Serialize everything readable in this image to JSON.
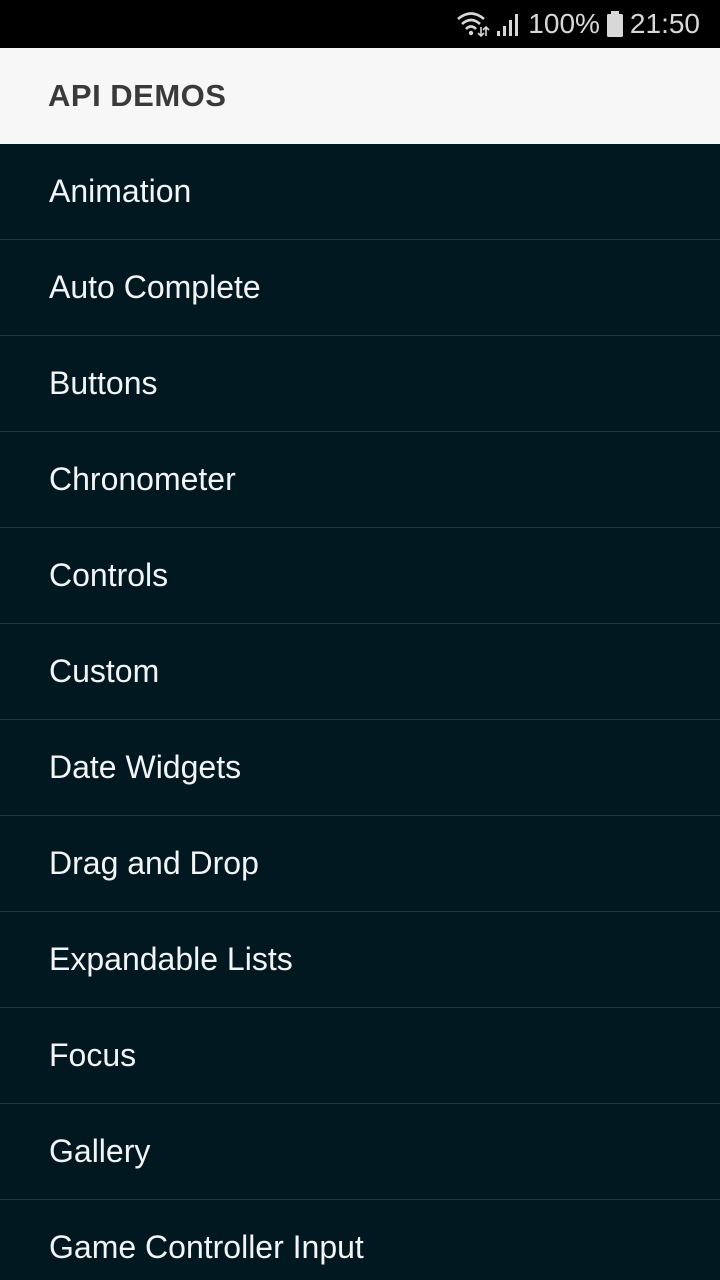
{
  "status_bar": {
    "battery": "100%",
    "time": "21:50",
    "icons": [
      "wifi-icon",
      "signal-icon",
      "battery-icon"
    ]
  },
  "action_bar": {
    "title": "API DEMOS"
  },
  "list": {
    "items": [
      {
        "label": "Animation"
      },
      {
        "label": "Auto Complete"
      },
      {
        "label": "Buttons"
      },
      {
        "label": "Chronometer"
      },
      {
        "label": "Controls"
      },
      {
        "label": "Custom"
      },
      {
        "label": "Date Widgets"
      },
      {
        "label": "Drag and Drop"
      },
      {
        "label": "Expandable Lists"
      },
      {
        "label": "Focus"
      },
      {
        "label": "Gallery"
      },
      {
        "label": "Game Controller Input"
      }
    ]
  },
  "colors": {
    "status_bg": "#000000",
    "action_bar_bg": "#f7f7f7",
    "list_bg": "#021821",
    "divider": "#1f3a44",
    "list_text": "#f2f4f5"
  }
}
